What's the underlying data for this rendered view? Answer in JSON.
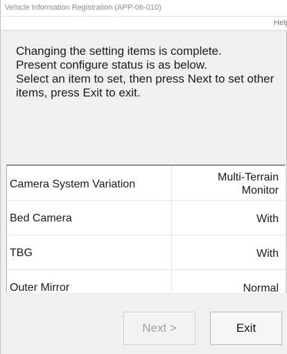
{
  "window": {
    "title": "Vehicle Information Registration (APP-06-010)",
    "help_label": "Help"
  },
  "message": {
    "line1": "Changing the setting items is complete.",
    "line2": "Present configure status is as below.",
    "line3": "Select an item to set, then press Next to set other items, press Exit to exit."
  },
  "settings": [
    {
      "name": "Camera System Variation",
      "value_line1": "Multi-Terrain",
      "value_line2": "Monitor"
    },
    {
      "name": "Bed Camera",
      "value_line1": "With",
      "value_line2": ""
    },
    {
      "name": "TBG",
      "value_line1": "With",
      "value_line2": ""
    },
    {
      "name": "Outer Mirror",
      "value_line1": "Normal",
      "value_line2": ""
    }
  ],
  "buttons": {
    "next_label": "Next >",
    "next_enabled": false,
    "exit_label": "Exit"
  }
}
